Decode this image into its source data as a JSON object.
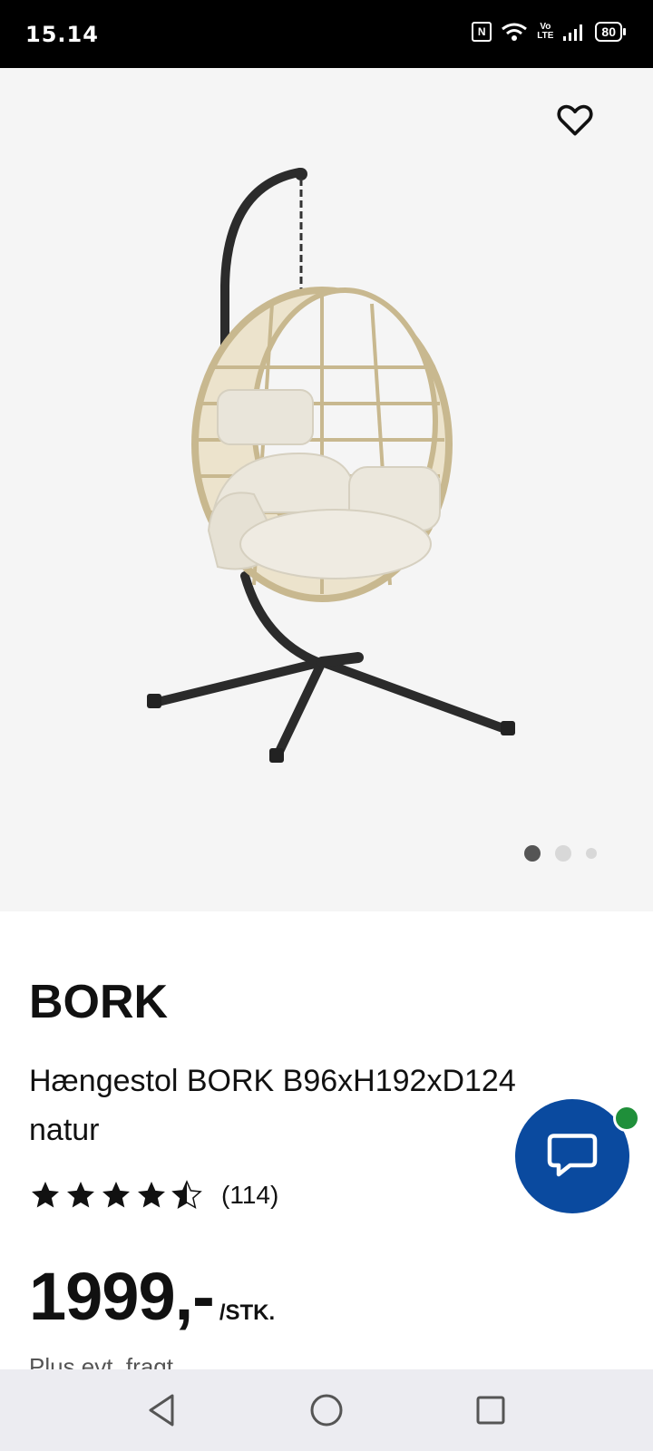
{
  "status_bar": {
    "time": "15.14",
    "nfc": "N",
    "volte_top": "Vo",
    "volte_bottom": "LTE",
    "battery": "80"
  },
  "gallery": {
    "favorite_icon": "heart-outline-icon",
    "image_description_icon": "hanging-chair-image",
    "dots_count": 3,
    "active_dot": 0,
    "colors": {
      "background": "#f5f5f5",
      "dot_active": "#555555",
      "dot_inactive": "#d8d8d8"
    }
  },
  "product": {
    "brand": "BORK",
    "name": "Hængestol BORK B96xH192xD124 natur",
    "rating": 4.5,
    "review_count": "(114)",
    "price": "1999,-",
    "price_unit": "/STK.",
    "shipping_note": "Plus evt. fragt"
  },
  "chat": {
    "icon": "chat-bubble-icon",
    "colors": {
      "button": "#0a4a9f",
      "online": "#1f8f3a"
    }
  },
  "nav_bar": {
    "back_icon": "back-triangle-icon",
    "home_icon": "home-circle-icon",
    "recents_icon": "recents-square-icon"
  }
}
